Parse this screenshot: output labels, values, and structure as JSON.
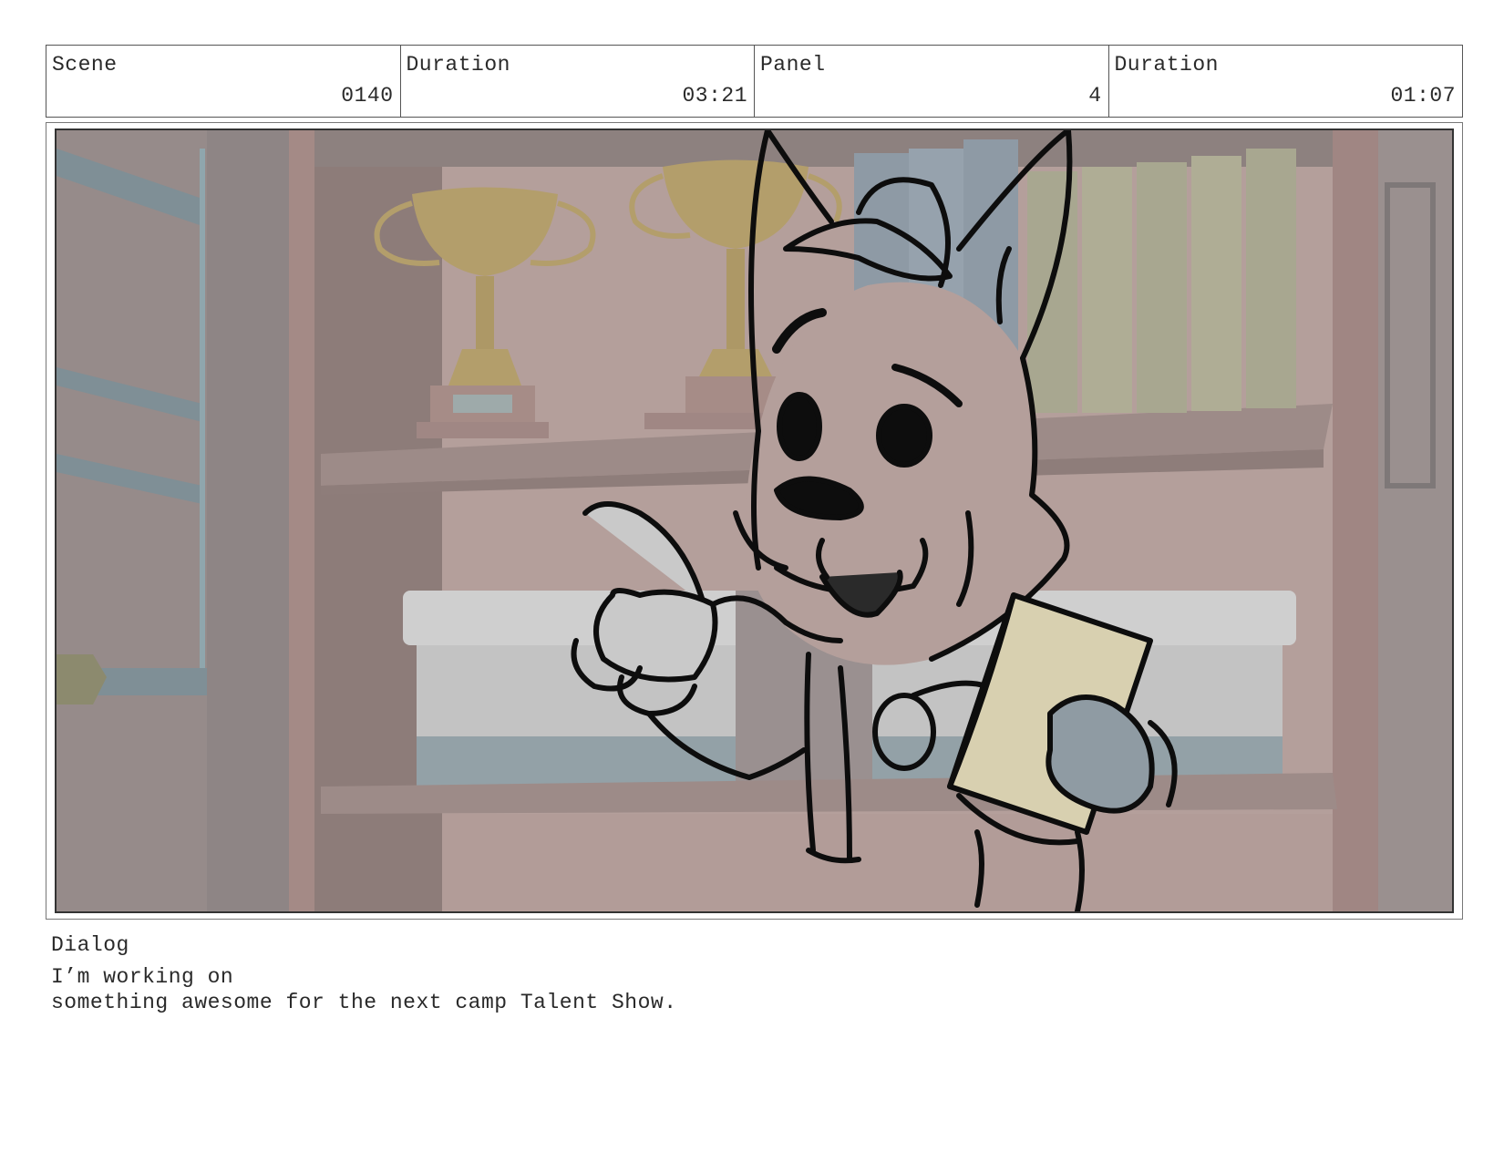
{
  "header": {
    "scene_label": "Scene",
    "scene_value": "0140",
    "scene_duration_label": "Duration",
    "scene_duration_value": "03:21",
    "panel_label": "Panel",
    "panel_value": "4",
    "panel_duration_label": "Duration",
    "panel_duration_value": "01:07"
  },
  "dialog": {
    "label": "Dialog",
    "line1": "I’m working on",
    "line2": "something awesome for the next camp Talent Show."
  }
}
